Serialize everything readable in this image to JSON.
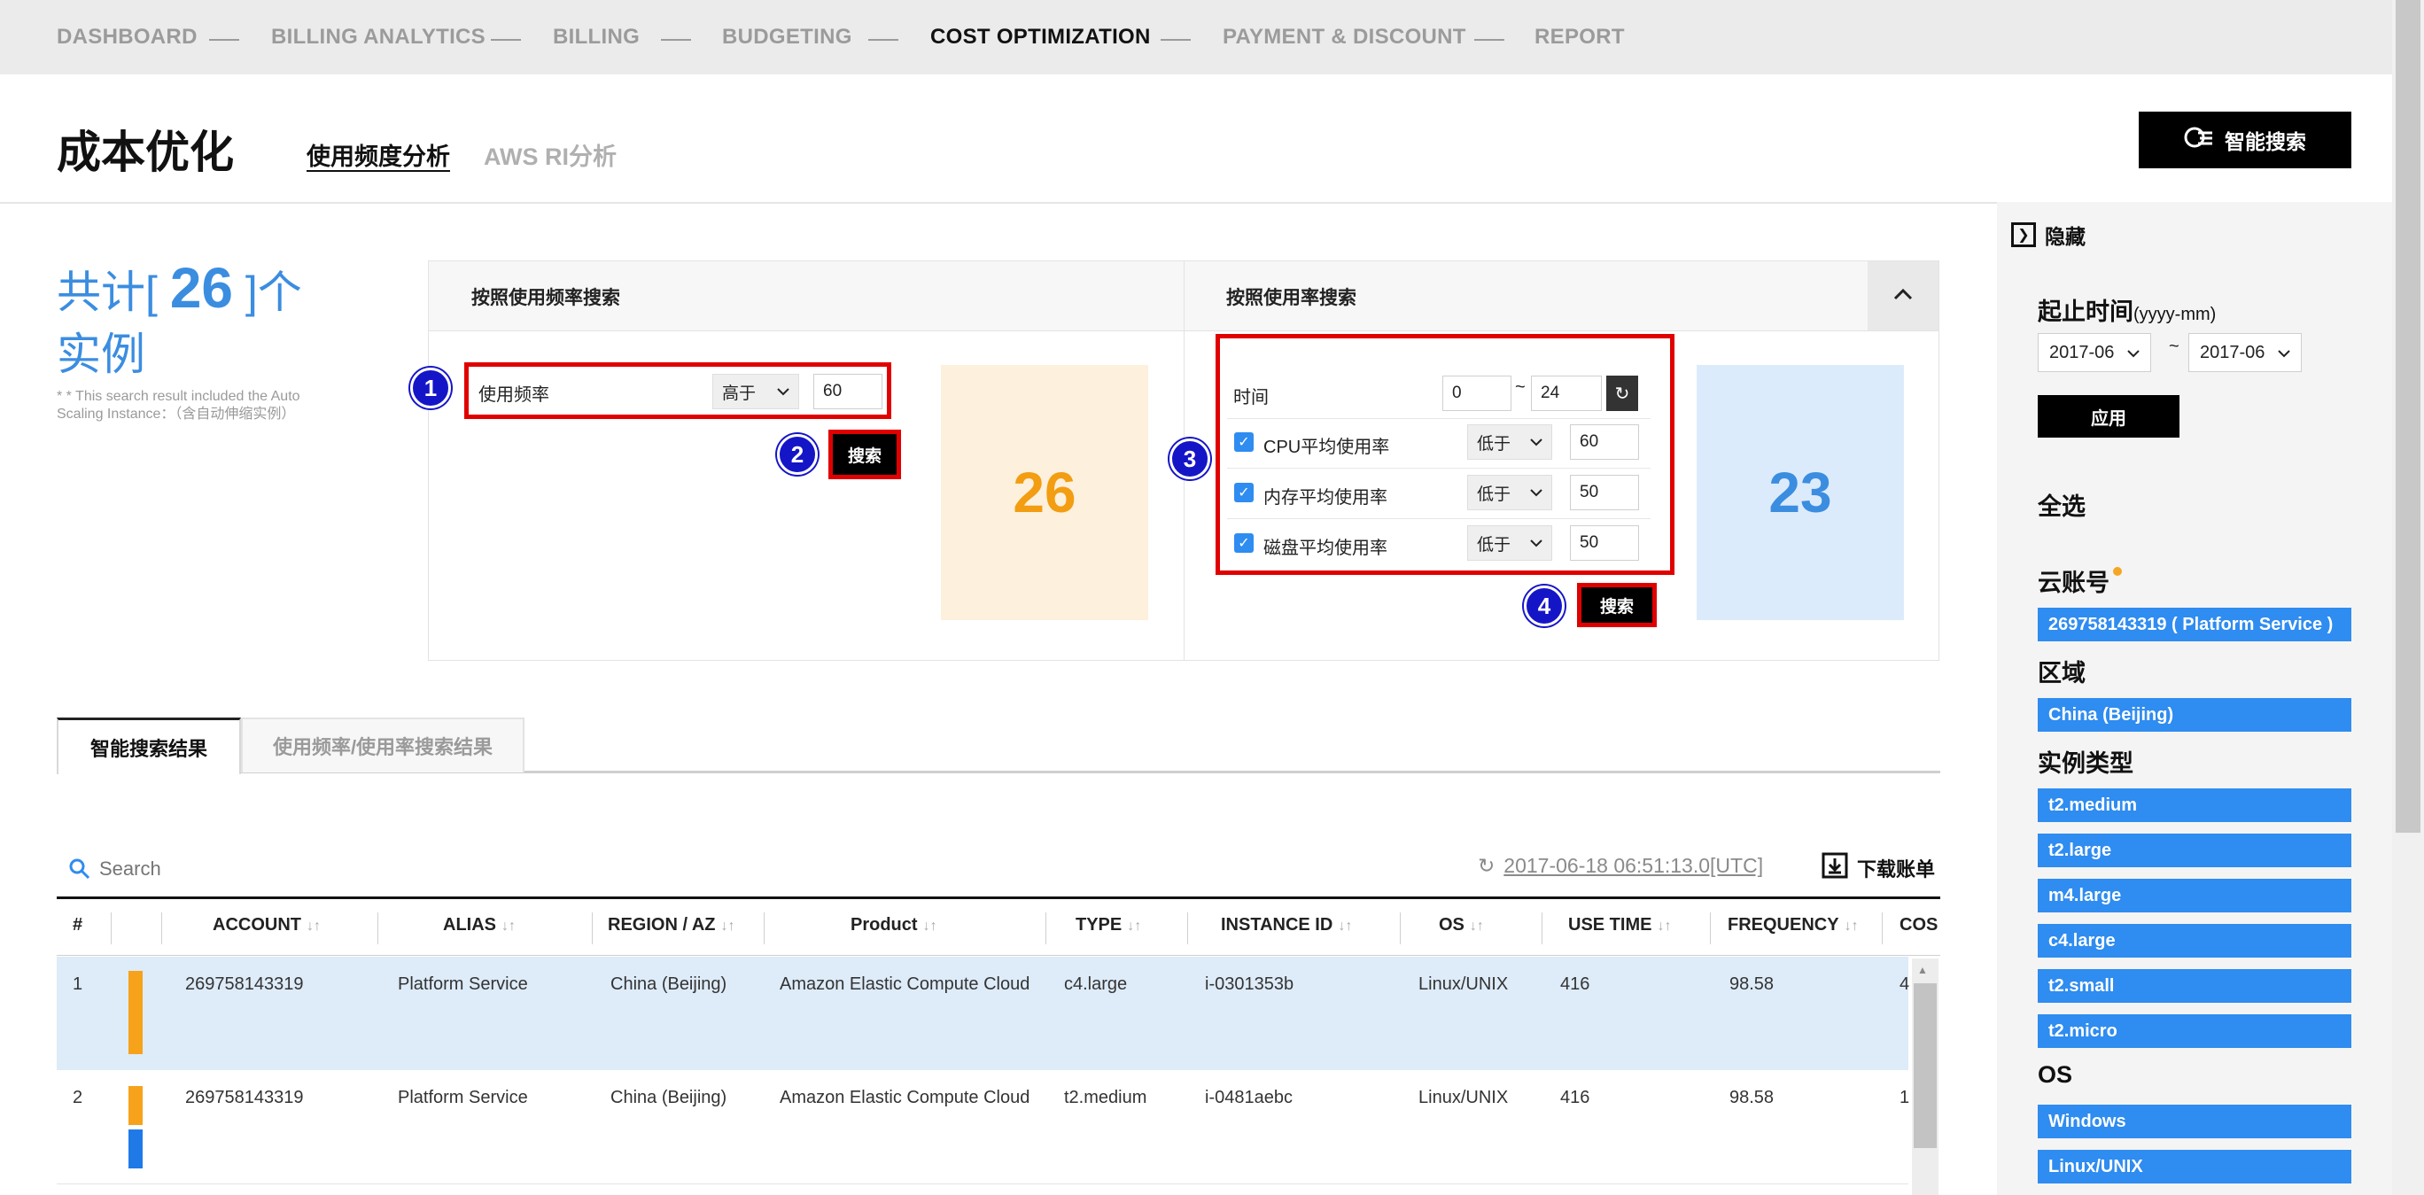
{
  "nav": {
    "items": [
      "DASHBOARD",
      "BILLING ANALYTICS",
      "BILLING",
      "BUDGETING",
      "COST OPTIMIZATION",
      "PAYMENT & DISCOUNT",
      "REPORT"
    ],
    "active": "COST OPTIMIZATION"
  },
  "header": {
    "title": "成本优化",
    "tabs": [
      "使用频度分析",
      "AWS RI分析"
    ],
    "smart_search": "智能搜索"
  },
  "summary": {
    "prefix": "共计[",
    "count": "26",
    "suffix": "]个",
    "line2": "实例",
    "note": "* * This search result included the Auto Scaling Instance：（含自动伸缩实例）"
  },
  "freq_search": {
    "title": "按照使用频率搜索",
    "field_label": "使用频率",
    "operator": "高于",
    "value": "60",
    "button": "搜索",
    "result": "26"
  },
  "usage_search": {
    "title": "按照使用率搜索",
    "time_label": "时间",
    "time_from": "0",
    "time_sep": "~",
    "time_to": "24",
    "rows": [
      {
        "label": "CPU平均使用率",
        "operator": "低于",
        "value": "60",
        "checked": true
      },
      {
        "label": "内存平均使用率",
        "operator": "低于",
        "value": "50",
        "checked": true
      },
      {
        "label": "磁盘平均使用率",
        "operator": "低于",
        "value": "50",
        "checked": true
      }
    ],
    "button": "搜索",
    "result": "23"
  },
  "badges": [
    "1",
    "2",
    "3",
    "4"
  ],
  "result_tabs": [
    "智能搜索结果",
    "使用频率/使用率搜索结果"
  ],
  "table": {
    "search_placeholder": "Search",
    "timestamp": "2017-06-18 06:51:13.0[UTC]",
    "download": "下载账单",
    "columns": [
      "#",
      "ACCOUNT",
      "ALIAS",
      "REGION / AZ",
      "Product",
      "TYPE",
      "INSTANCE ID",
      "OS",
      "USE TIME",
      "FREQUENCY",
      "COS"
    ],
    "sort_glyph": "↓↑",
    "rows": [
      {
        "num": "1",
        "account": "269758143319",
        "alias": "Platform Service",
        "region": "China (Beijing)",
        "product": "Amazon Elastic Compute Cloud",
        "type": "c4.large",
        "instance": "i-0301353b",
        "os": "Linux/UNIX",
        "use_time": "416",
        "frequency": "98.58",
        "cost": "4"
      },
      {
        "num": "2",
        "account": "269758143319",
        "alias": "Platform Service",
        "region": "China (Beijing)",
        "product": "Amazon Elastic Compute Cloud",
        "type": "t2.medium",
        "instance": "i-0481aebc",
        "os": "Linux/UNIX",
        "use_time": "416",
        "frequency": "98.58",
        "cost": "1"
      }
    ]
  },
  "sidebar": {
    "hide": "隐藏",
    "period_label": "起止时间",
    "period_format": "(yyyy-mm)",
    "from": "2017-06",
    "tilde": "~",
    "to": "2017-06",
    "apply": "应用",
    "select_all": "全选",
    "groups": [
      {
        "heading": "云账号",
        "items": [
          "269758143319 ( Platform Service )"
        ]
      },
      {
        "heading": "区域",
        "items": [
          "China (Beijing)"
        ]
      },
      {
        "heading": "实例类型",
        "items": [
          "t2.medium",
          "t2.large",
          "m4.large",
          "c4.large",
          "t2.small",
          "t2.micro"
        ]
      },
      {
        "heading": "OS",
        "items": [
          "Windows",
          "Linux/UNIX"
        ]
      }
    ]
  },
  "colors": {
    "accent_blue": "#2f8cf0",
    "count_blue": "#3b8de0",
    "orange": "#f29d12",
    "highlight_red": "#e00000",
    "badge_blue": "#1515c8"
  }
}
